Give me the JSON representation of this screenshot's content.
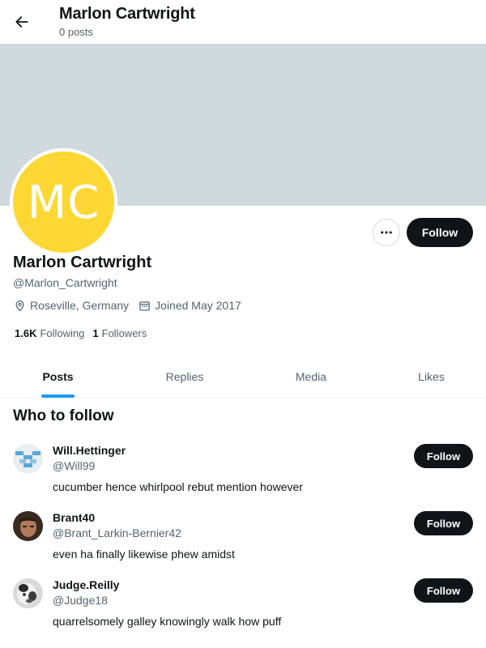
{
  "header": {
    "back_icon": "arrow-left-icon",
    "title": "Marlon Cartwright",
    "posts_count": "0 posts"
  },
  "profile": {
    "banner_color": "#cfd9de",
    "avatar_initials": "MC",
    "avatar_color": "#fdd835",
    "name": "Marlon Cartwright",
    "handle": "@Marlon_Cartwright",
    "location": "Roseville, Germany",
    "joined": "Joined May 2017",
    "following_count": "1.6K",
    "following_label": "Following",
    "followers_count": "1",
    "followers_label": "Followers",
    "follow_label": "Follow",
    "more_icon": "ellipsis-icon"
  },
  "tabs": [
    {
      "label": "Posts",
      "active": true
    },
    {
      "label": "Replies",
      "active": false
    },
    {
      "label": "Media",
      "active": false
    },
    {
      "label": "Likes",
      "active": false
    }
  ],
  "who_to_follow": {
    "title": "Who to follow",
    "items": [
      {
        "name": "Will.Hettinger",
        "handle": "@Will99",
        "bio": "cucumber hence whirlpool rebut mention however",
        "follow_label": "Follow"
      },
      {
        "name": "Brant40",
        "handle": "@Brant_Larkin-Bernier42",
        "bio": "even ha finally likewise phew amidst",
        "follow_label": "Follow"
      },
      {
        "name": "Judge.Reilly",
        "handle": "@Judge18",
        "bio": "quarrelsomely galley knowingly walk how puff",
        "follow_label": "Follow"
      }
    ]
  },
  "colors": {
    "accent": "#1d9bf0",
    "button_dark": "#0f1419",
    "secondary_text": "#536471"
  }
}
